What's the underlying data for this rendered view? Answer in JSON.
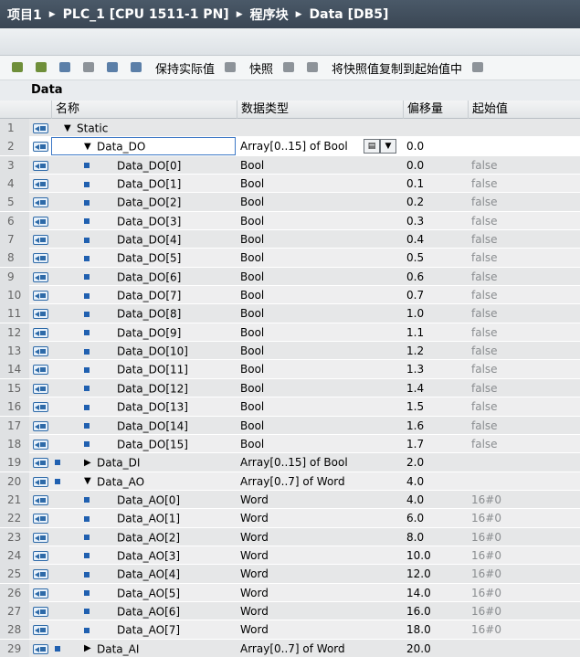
{
  "breadcrumb": [
    "项目1",
    "PLC_1 [CPU 1511-1 PN]",
    "程序块",
    "Data [DB5]"
  ],
  "toolbar": {
    "keep_actual": "保持实际值",
    "snapshot": "快照",
    "copy_snapshot": "将快照值复制到起始值中"
  },
  "block_name": "Data",
  "columns": {
    "name": "名称",
    "type": "数据类型",
    "offset": "偏移量",
    "start": "起始值"
  },
  "rows": [
    {
      "n": "1",
      "level": 0,
      "expand": "▼",
      "name": "Static",
      "type": "",
      "offset": "",
      "start": ""
    },
    {
      "n": "2",
      "level": 1,
      "expand": "▼",
      "name": "Data_DO",
      "type": "Array[0..15] of Bool",
      "offset": "0.0",
      "start": "",
      "selected": true
    },
    {
      "n": "3",
      "level": 2,
      "expand": "",
      "name": "Data_DO[0]",
      "type": "Bool",
      "offset": "0.0",
      "start": "false"
    },
    {
      "n": "4",
      "level": 2,
      "expand": "",
      "name": "Data_DO[1]",
      "type": "Bool",
      "offset": "0.1",
      "start": "false"
    },
    {
      "n": "5",
      "level": 2,
      "expand": "",
      "name": "Data_DO[2]",
      "type": "Bool",
      "offset": "0.2",
      "start": "false"
    },
    {
      "n": "6",
      "level": 2,
      "expand": "",
      "name": "Data_DO[3]",
      "type": "Bool",
      "offset": "0.3",
      "start": "false"
    },
    {
      "n": "7",
      "level": 2,
      "expand": "",
      "name": "Data_DO[4]",
      "type": "Bool",
      "offset": "0.4",
      "start": "false"
    },
    {
      "n": "8",
      "level": 2,
      "expand": "",
      "name": "Data_DO[5]",
      "type": "Bool",
      "offset": "0.5",
      "start": "false"
    },
    {
      "n": "9",
      "level": 2,
      "expand": "",
      "name": "Data_DO[6]",
      "type": "Bool",
      "offset": "0.6",
      "start": "false"
    },
    {
      "n": "10",
      "level": 2,
      "expand": "",
      "name": "Data_DO[7]",
      "type": "Bool",
      "offset": "0.7",
      "start": "false"
    },
    {
      "n": "11",
      "level": 2,
      "expand": "",
      "name": "Data_DO[8]",
      "type": "Bool",
      "offset": "1.0",
      "start": "false"
    },
    {
      "n": "12",
      "level": 2,
      "expand": "",
      "name": "Data_DO[9]",
      "type": "Bool",
      "offset": "1.1",
      "start": "false"
    },
    {
      "n": "13",
      "level": 2,
      "expand": "",
      "name": "Data_DO[10]",
      "type": "Bool",
      "offset": "1.2",
      "start": "false"
    },
    {
      "n": "14",
      "level": 2,
      "expand": "",
      "name": "Data_DO[11]",
      "type": "Bool",
      "offset": "1.3",
      "start": "false"
    },
    {
      "n": "15",
      "level": 2,
      "expand": "",
      "name": "Data_DO[12]",
      "type": "Bool",
      "offset": "1.4",
      "start": "false"
    },
    {
      "n": "16",
      "level": 2,
      "expand": "",
      "name": "Data_DO[13]",
      "type": "Bool",
      "offset": "1.5",
      "start": "false"
    },
    {
      "n": "17",
      "level": 2,
      "expand": "",
      "name": "Data_DO[14]",
      "type": "Bool",
      "offset": "1.6",
      "start": "false"
    },
    {
      "n": "18",
      "level": 2,
      "expand": "",
      "name": "Data_DO[15]",
      "type": "Bool",
      "offset": "1.7",
      "start": "false"
    },
    {
      "n": "19",
      "level": 1,
      "expand": "▶",
      "name": "Data_DI",
      "type": "Array[0..15] of Bool",
      "offset": "2.0",
      "start": ""
    },
    {
      "n": "20",
      "level": 1,
      "expand": "▼",
      "name": "Data_AO",
      "type": "Array[0..7] of Word",
      "offset": "4.0",
      "start": ""
    },
    {
      "n": "21",
      "level": 2,
      "expand": "",
      "name": "Data_AO[0]",
      "type": "Word",
      "offset": "4.0",
      "start": "16#0"
    },
    {
      "n": "22",
      "level": 2,
      "expand": "",
      "name": "Data_AO[1]",
      "type": "Word",
      "offset": "6.0",
      "start": "16#0"
    },
    {
      "n": "23",
      "level": 2,
      "expand": "",
      "name": "Data_AO[2]",
      "type": "Word",
      "offset": "8.0",
      "start": "16#0"
    },
    {
      "n": "24",
      "level": 2,
      "expand": "",
      "name": "Data_AO[3]",
      "type": "Word",
      "offset": "10.0",
      "start": "16#0"
    },
    {
      "n": "25",
      "level": 2,
      "expand": "",
      "name": "Data_AO[4]",
      "type": "Word",
      "offset": "12.0",
      "start": "16#0"
    },
    {
      "n": "26",
      "level": 2,
      "expand": "",
      "name": "Data_AO[5]",
      "type": "Word",
      "offset": "14.0",
      "start": "16#0"
    },
    {
      "n": "27",
      "level": 2,
      "expand": "",
      "name": "Data_AO[6]",
      "type": "Word",
      "offset": "16.0",
      "start": "16#0"
    },
    {
      "n": "28",
      "level": 2,
      "expand": "",
      "name": "Data_AO[7]",
      "type": "Word",
      "offset": "18.0",
      "start": "16#0"
    },
    {
      "n": "29",
      "level": 1,
      "expand": "▶",
      "name": "Data_AI",
      "type": "Array[0..7] of Word",
      "offset": "20.0",
      "start": ""
    }
  ]
}
